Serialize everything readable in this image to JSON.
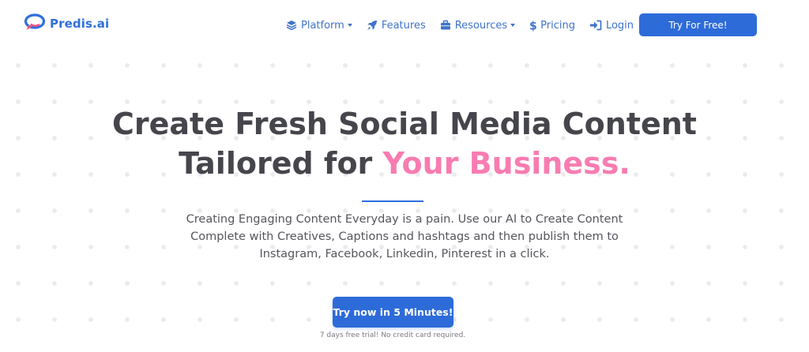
{
  "brand": {
    "name": "Predis.ai",
    "logo_icon": "speech-bubble-logo",
    "primary_color": "#2d6bd9",
    "accent_color": "#f87cb1"
  },
  "nav": {
    "items": [
      {
        "label": "Platform",
        "icon": "layers-icon",
        "dropdown": true
      },
      {
        "label": "Features",
        "icon": "rocket-icon",
        "dropdown": false
      },
      {
        "label": "Resources",
        "icon": "briefcase-icon",
        "dropdown": true
      },
      {
        "label": "Pricing",
        "icon": "dollar-icon",
        "dropdown": false
      },
      {
        "label": "Login",
        "icon": "login-icon",
        "dropdown": false
      }
    ],
    "cta_label": "Try For Free!"
  },
  "hero": {
    "title_line1": "Create Fresh Social Media Content",
    "title_line2_prefix": "Tailored for ",
    "title_line2_accent": "Your Business.",
    "description": "Creating Engaging Content Everyday is a pain. Use our AI to Create Content Complete with Creatives, Captions and hashtags and then publish them to Instagram, Facebook, Linkedin, Pinterest in a click.",
    "cta_label": "Try now in 5 Minutes!",
    "cta_note": "7 days free trial! No credit card required."
  }
}
